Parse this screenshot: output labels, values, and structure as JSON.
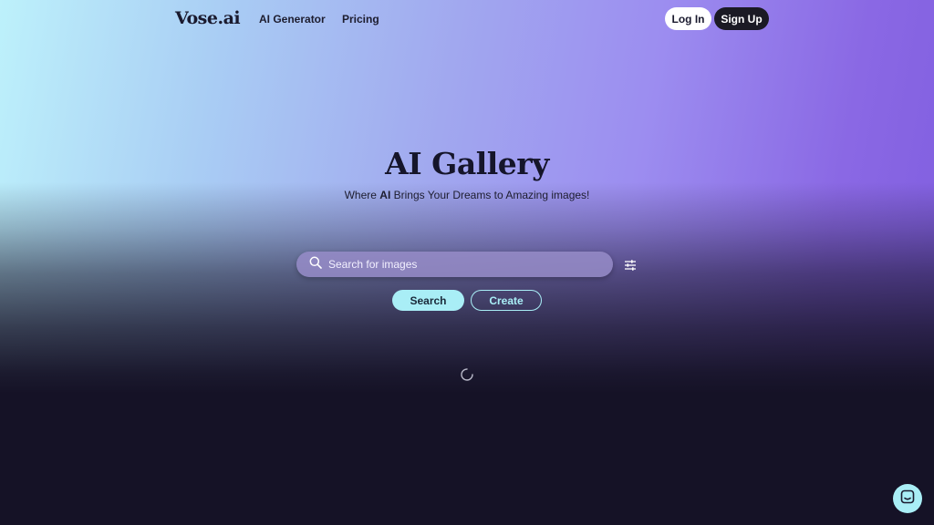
{
  "nav": {
    "logo": "Vose.ai",
    "links": [
      "AI Generator",
      "Pricing"
    ],
    "login_label": "Log In",
    "signup_label": "Sign Up"
  },
  "hero": {
    "title": "AI Gallery",
    "subtitle_prefix": "Where ",
    "subtitle_bold": "AI",
    "subtitle_suffix": " Brings Your Dreams to Amazing images!"
  },
  "search": {
    "placeholder": "Search for images",
    "search_label": "Search",
    "create_label": "Create"
  },
  "icons": {
    "search": "search-icon",
    "filter": "sliders-icon",
    "loading": "loading-spinner-icon",
    "chat": "chat-icon"
  },
  "colors": {
    "accent": "#a9eef6",
    "dark_bg": "#151226",
    "gradient_start": "#bdf1fb",
    "gradient_end": "#7f5ddf"
  }
}
